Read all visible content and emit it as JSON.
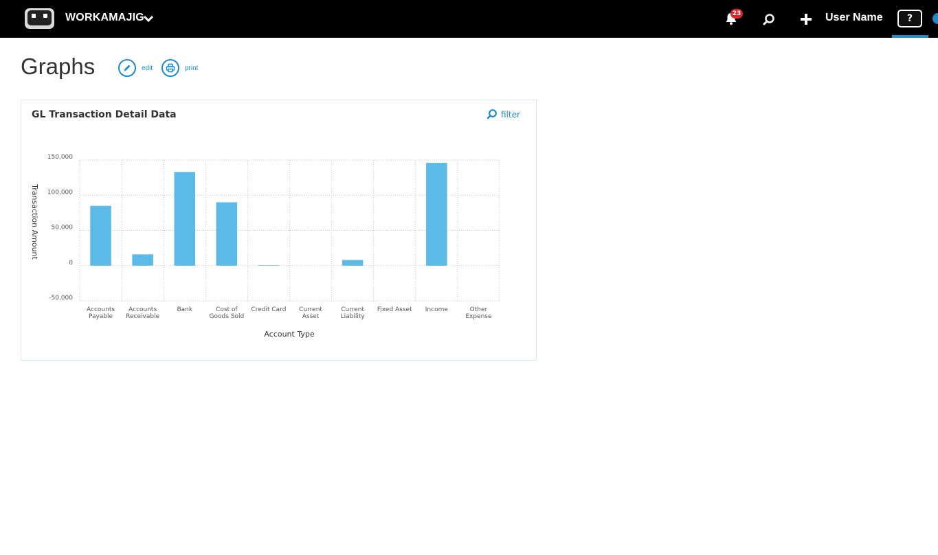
{
  "topbar": {
    "app_name": "WORKAMAJIG",
    "notification_count": "23",
    "user_name": "User Name",
    "help_label": "?",
    "icons": [
      "robot-logo-icon",
      "chevron-down-icon",
      "bell-icon",
      "search-icon",
      "plus-icon",
      "help-icon"
    ]
  },
  "page": {
    "title": "Graphs",
    "edit_label": "edit",
    "print_label": "print"
  },
  "widget": {
    "title": "GL Transaction Detail Data",
    "filter_label": "filter"
  },
  "colors": {
    "topbar": "#000000",
    "accent": "#1a8ccc",
    "bar": "#5bbbe6",
    "badge": "#d9272e",
    "grid": "#c8c8c8"
  },
  "chart_data": {
    "type": "bar",
    "title": "",
    "xlabel": "Account Type",
    "ylabel": "Transaction Amount",
    "ylim": [
      -50000,
      150000
    ],
    "yticks": [
      150000,
      100000,
      50000,
      0,
      -50000
    ],
    "ytick_labels": [
      "150,000",
      "100,000",
      "50,000",
      "0",
      "-50,000"
    ],
    "grid": true,
    "legend": "none",
    "categories": [
      [
        "Accounts",
        "Payable"
      ],
      [
        "Accounts",
        "Receivable"
      ],
      [
        "Bank"
      ],
      [
        "Cost of",
        "Goods Sold"
      ],
      [
        "Credit Card"
      ],
      [
        "Current",
        "Asset"
      ],
      [
        "Current",
        "Liability"
      ],
      [
        "Fixed Asset"
      ],
      [
        "Income"
      ],
      [
        "Other",
        "Expense"
      ]
    ],
    "values": [
      85000,
      16000,
      133000,
      90000,
      500,
      0,
      8000,
      0,
      146000,
      0
    ]
  }
}
